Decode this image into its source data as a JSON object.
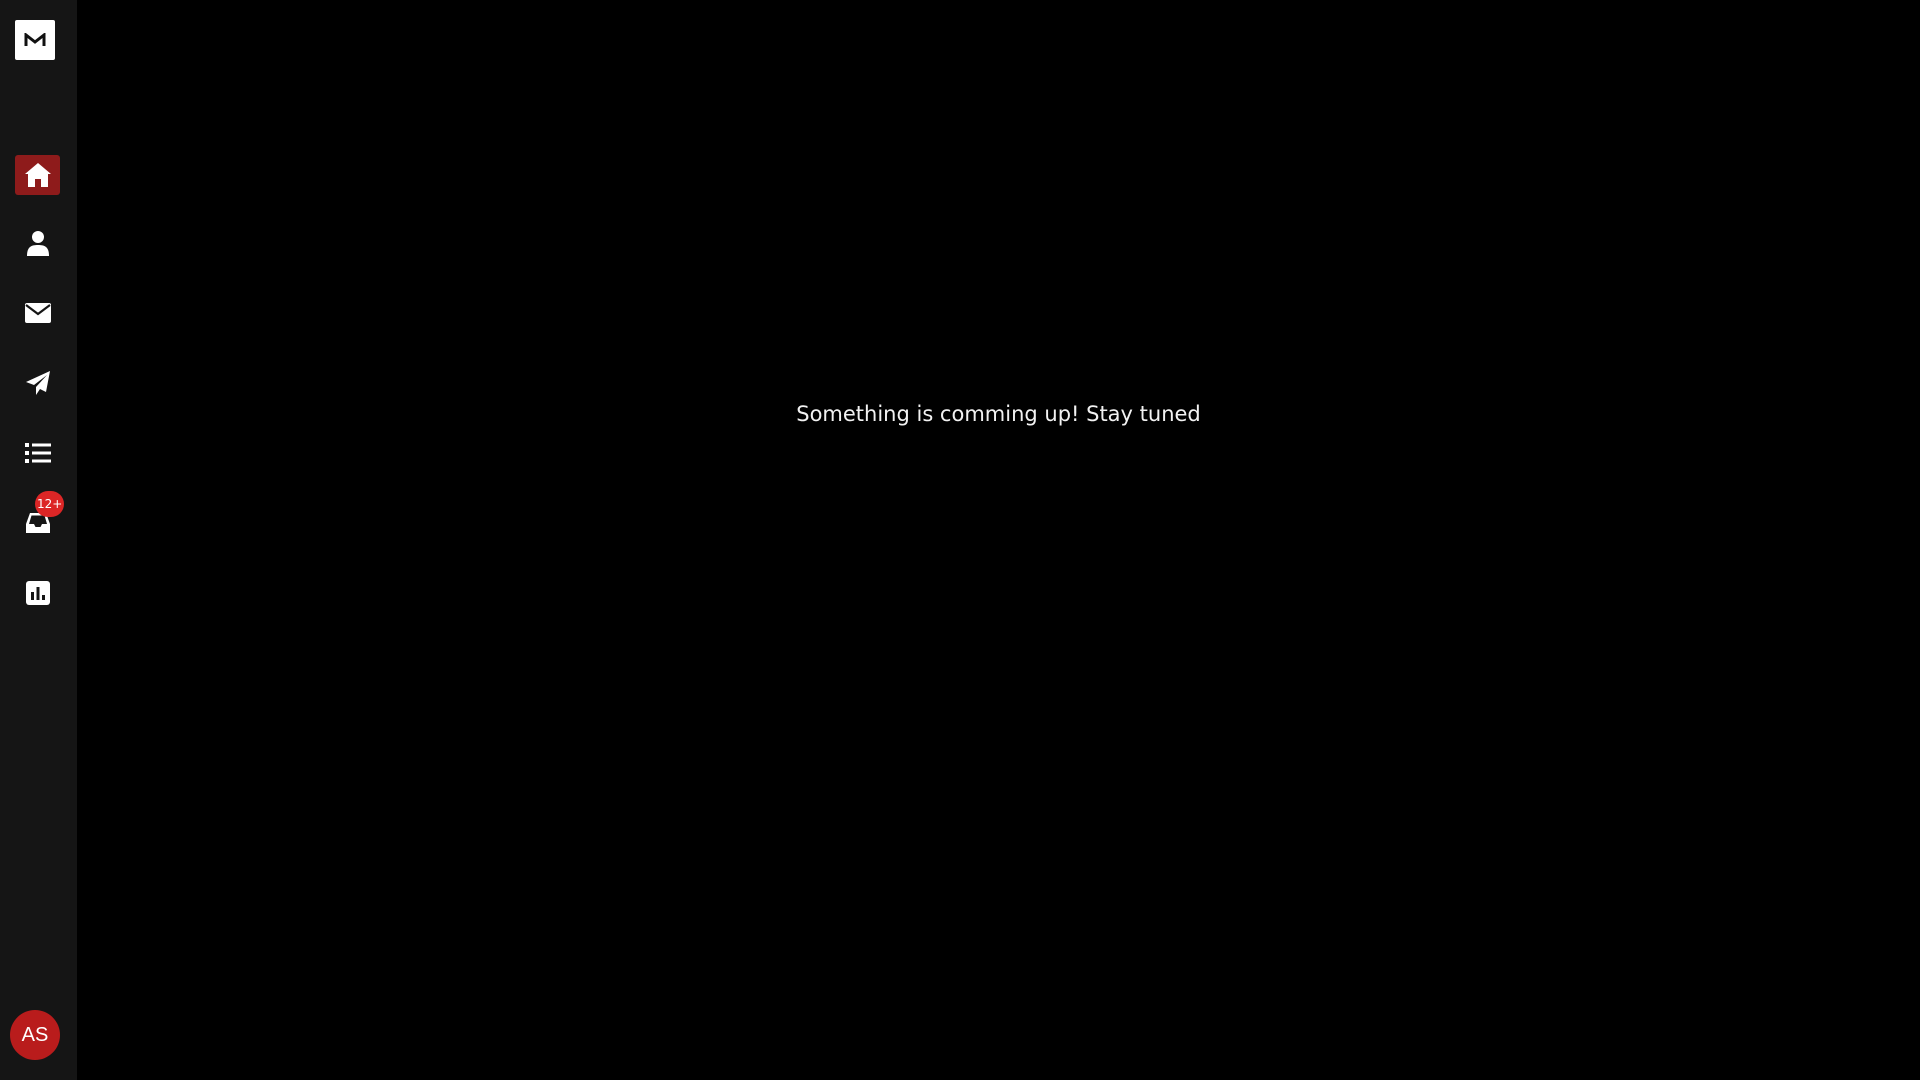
{
  "sidebar": {
    "logo_letter": "M",
    "items": [
      {
        "name": "home",
        "icon": "home-icon",
        "active": true
      },
      {
        "name": "profile",
        "icon": "user-icon",
        "active": false
      },
      {
        "name": "mail",
        "icon": "envelope-icon",
        "active": false
      },
      {
        "name": "send",
        "icon": "paper-plane-icon",
        "active": false
      },
      {
        "name": "list",
        "icon": "list-icon",
        "active": false
      },
      {
        "name": "inbox",
        "icon": "inbox-icon",
        "active": false,
        "badge": "12+"
      },
      {
        "name": "analytics",
        "icon": "chart-icon",
        "active": false
      }
    ],
    "avatar_initials": "AS"
  },
  "main": {
    "message": "Something is comming up! Stay tuned"
  },
  "colors": {
    "sidebar_bg": "#151515",
    "main_bg": "#000000",
    "active_item": "#8e1b1b",
    "badge": "#dc2626",
    "avatar": "#b91c1c"
  }
}
